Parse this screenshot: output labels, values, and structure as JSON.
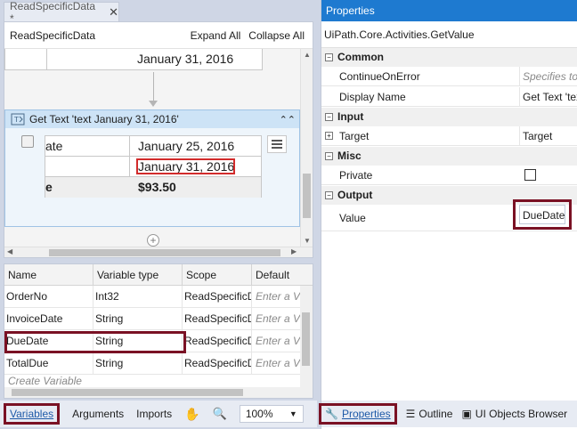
{
  "designer": {
    "doc_tab": "ReadSpecificData *",
    "doc_tab_close": "✕",
    "header_title": "ReadSpecificData",
    "expand_all": "Expand All",
    "collapse_all": "Collapse All",
    "top_cell_value": "January 31, 2016",
    "activity_title": "Get Text 'text  January 31, 2016'",
    "rows": [
      {
        "c1": "ate",
        "c2": "January 25, 2016"
      },
      {
        "c1": "",
        "c2": "January 31, 2016"
      },
      {
        "c1": "e",
        "c2": "$93.50"
      }
    ]
  },
  "variables": {
    "columns": [
      "Name",
      "Variable type",
      "Scope",
      "Default"
    ],
    "rows": [
      {
        "name": "OrderNo",
        "type": "Int32",
        "scope": "ReadSpecificD",
        "default": "Enter a V"
      },
      {
        "name": "InvoiceDate",
        "type": "String",
        "scope": "ReadSpecificD",
        "default": "Enter a V"
      },
      {
        "name": "DueDate",
        "type": "String",
        "scope": "ReadSpecificD",
        "default": "Enter a V"
      },
      {
        "name": "TotalDue",
        "type": "String",
        "scope": "ReadSpecificD",
        "default": "Enter a V"
      }
    ],
    "create": "Create Variable"
  },
  "bottom_left": {
    "variables": "Variables",
    "arguments": "Arguments",
    "imports": "Imports",
    "zoom": "100%"
  },
  "properties": {
    "title": "Properties",
    "type": "UiPath.Core.Activities.GetValue",
    "categories": {
      "common": "Common",
      "input": "Input",
      "misc": "Misc",
      "output": "Output"
    },
    "continue_on_error": "ContinueOnError",
    "continue_on_error_value": "Specifies to",
    "display_name": "Display Name",
    "display_name_value": "Get Text 'text",
    "target": "Target",
    "target_value": "Target",
    "private": "Private",
    "value": "Value",
    "value_value": "DueDate"
  },
  "bottom_right": {
    "properties": "Properties",
    "outline": "Outline",
    "ui_objects": "UI Objects Browser"
  }
}
